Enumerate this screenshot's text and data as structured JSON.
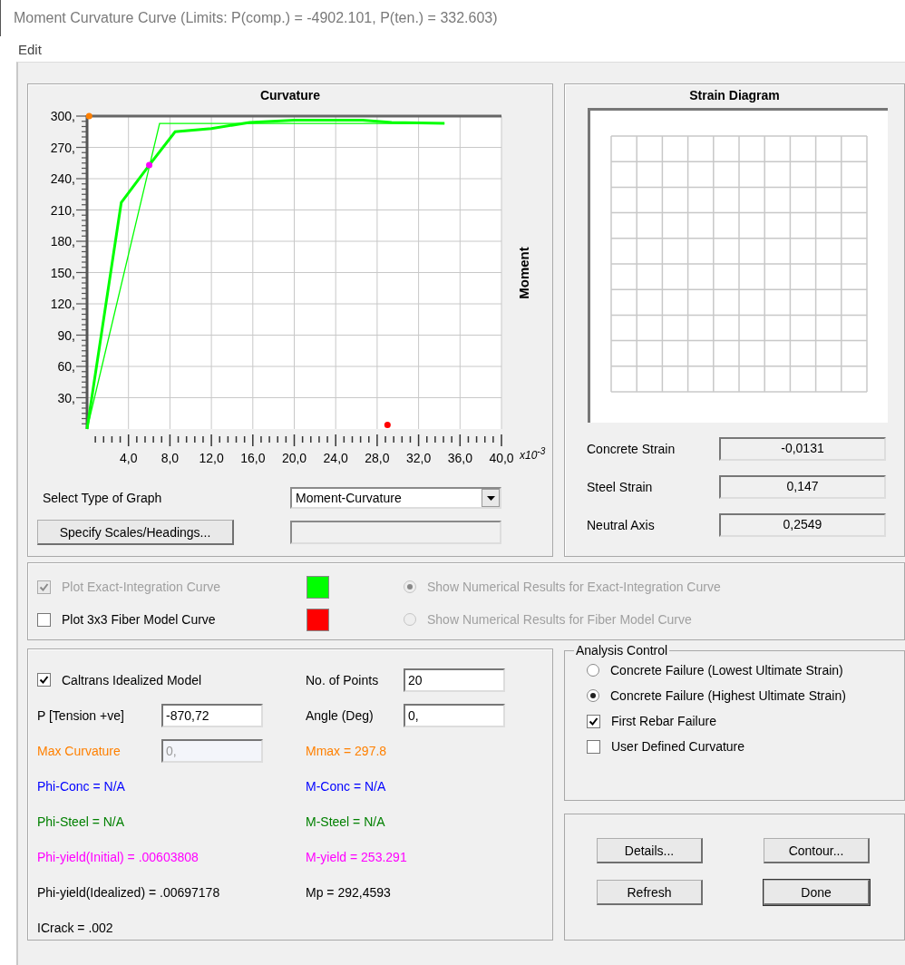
{
  "window": {
    "title": "Moment Curvature Curve (Limits:  P(comp.) = -4902.101, P(ten.) = 332.603)"
  },
  "menu": [
    {
      "label": "Edit"
    }
  ],
  "curvature_panel": {
    "chart_data": {
      "type": "line",
      "grid": true,
      "title": "Curvature",
      "ylabel": "Moment",
      "xlabel": "x10$^{-3}$",
      "xlim": [
        0,
        40
      ],
      "ylim": [
        0,
        300
      ],
      "xticks": [
        {
          "value": 4,
          "label": "4,0"
        },
        {
          "value": 8,
          "label": "8,0"
        },
        {
          "value": 12,
          "label": "12,0"
        },
        {
          "value": 16,
          "label": "16,0"
        },
        {
          "value": 20,
          "label": "20,0"
        },
        {
          "value": 24,
          "label": "24,0"
        },
        {
          "value": 28,
          "label": "28,0"
        },
        {
          "value": 32,
          "label": "32,0"
        },
        {
          "value": 36,
          "label": "36,0"
        },
        {
          "value": 40,
          "label": "40,0"
        }
      ],
      "yticks": [
        {
          "value": 30,
          "label": "30,"
        },
        {
          "value": 60,
          "label": "60,"
        },
        {
          "value": 90,
          "label": "90,"
        },
        {
          "value": 120,
          "label": "120,"
        },
        {
          "value": 150,
          "label": "150,"
        },
        {
          "value": 180,
          "label": "180,"
        },
        {
          "value": 210,
          "label": "210,"
        },
        {
          "value": 240,
          "label": "240,"
        },
        {
          "value": 270,
          "label": "270,"
        },
        {
          "value": 300,
          "label": "300,"
        }
      ],
      "series": [
        {
          "color": "#00ff00",
          "x": [
            0,
            3.3,
            6.0,
            8.5,
            12.0,
            15.7,
            20.0,
            26.6,
            29.4,
            34.5
          ],
          "values": [
            0,
            217,
            253,
            285,
            288,
            294,
            296,
            296,
            294,
            293
          ]
        },
        {
          "color": "#00ff00",
          "x": [
            0,
            7.0,
            34.5
          ],
          "values": [
            0,
            293,
            293
          ]
        },
        {
          "color": "#ff00ff",
          "marker": "circle",
          "x": [
            6
          ],
          "values": [
            253
          ]
        },
        {
          "color": "#ff0000",
          "marker": "circle",
          "x": [
            29
          ],
          "values": [
            4
          ]
        },
        {
          "color": "#ff8000",
          "marker": "circle",
          "x": [
            0.2
          ],
          "values": [
            300
          ]
        }
      ]
    },
    "graph_type": {
      "label": "Select Type of Graph",
      "value": "Moment-Curvature"
    },
    "scales_button": "Specify Scales/Headings..."
  },
  "strain_panel": {
    "title": "Strain Diagram",
    "readouts": [
      {
        "label": "Concrete Strain",
        "value": "-0,0131"
      },
      {
        "label": "Steel Strain",
        "value": "0,147"
      },
      {
        "label": "Neutral Axis",
        "value": "0,2549"
      }
    ]
  },
  "curve_options": [
    {
      "label": "Plot Exact-Integration Curve",
      "checked": true,
      "disabled": true,
      "color": "#00ff00",
      "results_label": "Show Numerical Results for Exact-Integration Curve",
      "selected": true,
      "results_disabled": true
    },
    {
      "label": "Plot 3x3 Fiber Model Curve",
      "checked": false,
      "disabled": false,
      "color": "#ff0000",
      "results_label": "Show Numerical Results for Fiber Model Curve",
      "selected": false,
      "results_disabled": true
    }
  ],
  "model_rows": [
    [
      {
        "kind": "checkbox",
        "label": "Caltrans Idealized Model",
        "checked": true
      },
      {
        "kind": "input",
        "label": "No. of Points",
        "value": "20",
        "disabled": false,
        "color": "#000000"
      }
    ],
    [
      {
        "kind": "input",
        "label": "P [Tension +ve]",
        "value": "-870,72",
        "disabled": false,
        "color": "#000000"
      },
      {
        "kind": "input",
        "label": "Angle (Deg)",
        "value": "0,",
        "disabled": false,
        "color": "#000000"
      }
    ],
    [
      {
        "kind": "input",
        "label": "Max Curvature",
        "value": "0,",
        "disabled": true,
        "color": "#ff8000"
      },
      {
        "kind": "text",
        "text": "Mmax = 297.8",
        "color": "#ff8000"
      }
    ],
    [
      {
        "kind": "text",
        "text": "Phi-Conc = N/A",
        "color": "#0000ff"
      },
      {
        "kind": "text",
        "text": "M-Conc = N/A",
        "color": "#0000ff"
      }
    ],
    [
      {
        "kind": "text",
        "text": "Phi-Steel = N/A",
        "color": "#008000"
      },
      {
        "kind": "text",
        "text": "M-Steel = N/A",
        "color": "#008000"
      }
    ],
    [
      {
        "kind": "text",
        "text": "Phi-yield(Initial) = .00603808",
        "color": "#ff00ff"
      },
      {
        "kind": "text",
        "text": "M-yield = 253.291",
        "color": "#ff00ff"
      }
    ],
    [
      {
        "kind": "text",
        "text": "Phi-yield(Idealized) = .00697178",
        "color": "#000000"
      },
      {
        "kind": "text",
        "text": "Mp = 292,4593",
        "color": "#000000"
      }
    ],
    [
      {
        "kind": "text",
        "text": "ICrack =  .002",
        "color": "#000000"
      }
    ]
  ],
  "analysis_control": {
    "title": "Analysis Control",
    "options": [
      {
        "kind": "radio",
        "label": "Concrete Failure (Lowest Ultimate Strain)",
        "selected": false
      },
      {
        "kind": "radio",
        "label": "Concrete Failure (Highest Ultimate Strain)",
        "selected": true
      },
      {
        "kind": "checkbox",
        "label": "First Rebar Failure",
        "checked": true
      },
      {
        "kind": "checkbox",
        "label": "User Defined Curvature",
        "checked": false
      }
    ]
  },
  "buttons": [
    {
      "label": "Details...",
      "default": false
    },
    {
      "label": "Contour...",
      "default": false
    },
    {
      "label": "Refresh",
      "default": false
    },
    {
      "label": "Done",
      "default": true
    }
  ]
}
